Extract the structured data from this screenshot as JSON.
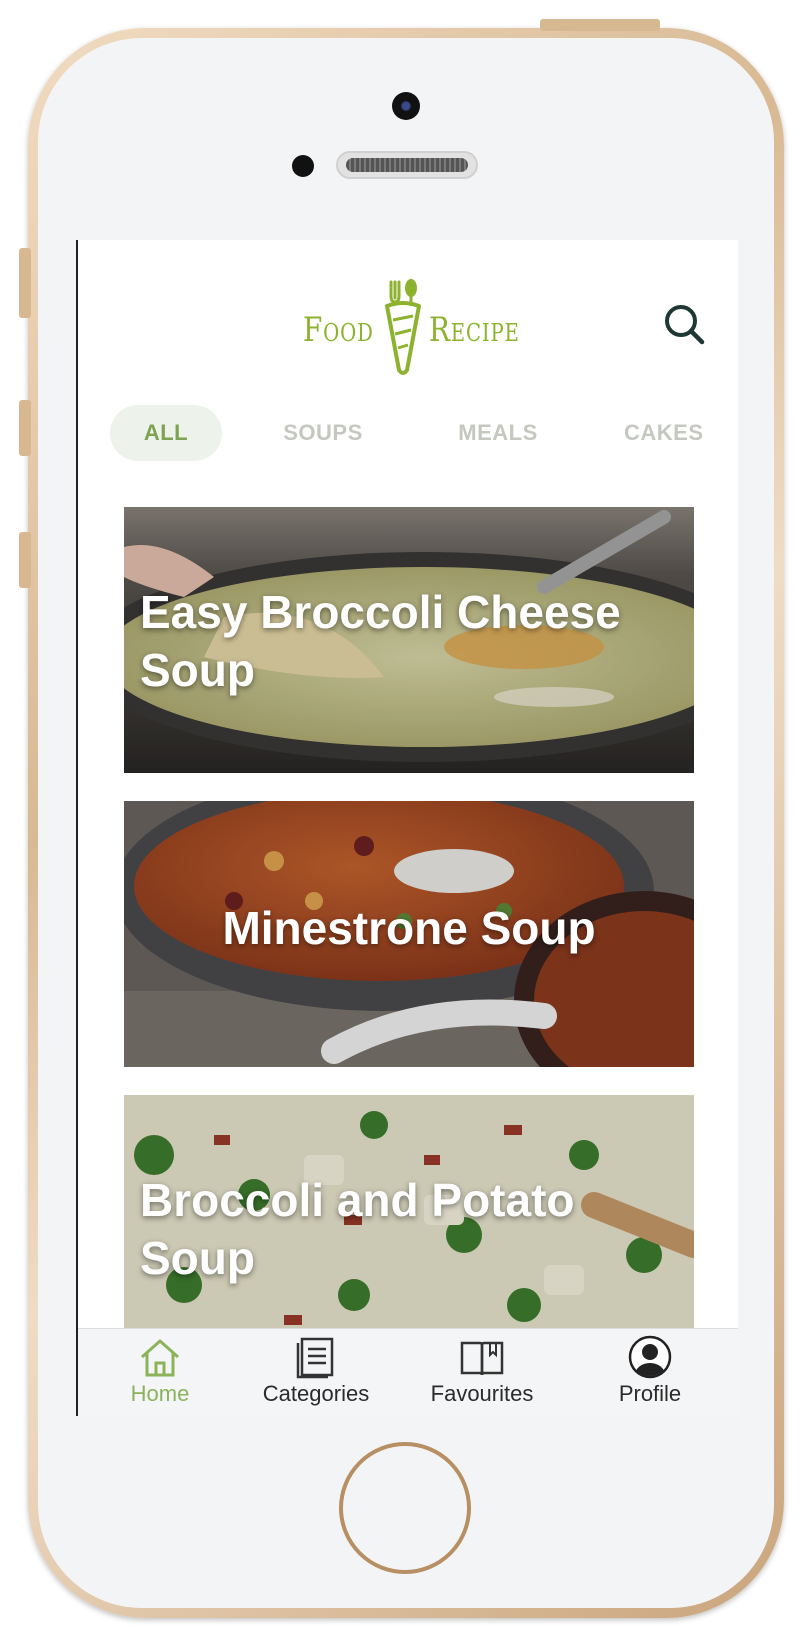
{
  "app": {
    "logo_left": "Food",
    "logo_right": "Recipe",
    "accent_color": "#8cb22e"
  },
  "header": {
    "search_icon": "search-icon"
  },
  "tabs": [
    {
      "label": "ALL",
      "active": true
    },
    {
      "label": "SOUPS",
      "active": false
    },
    {
      "label": "MEALS",
      "active": false
    },
    {
      "label": "CAKES",
      "active": false
    }
  ],
  "recipes": [
    {
      "title": "Easy Broccoli Cheese Soup"
    },
    {
      "title": "Minestrone Soup"
    },
    {
      "title": "Broccoli and Potato Soup"
    }
  ],
  "bottom_nav": [
    {
      "label": "Home",
      "icon": "home-icon",
      "active": true
    },
    {
      "label": "Categories",
      "icon": "list-icon",
      "active": false
    },
    {
      "label": "Favourites",
      "icon": "book-icon",
      "active": false
    },
    {
      "label": "Profile",
      "icon": "profile-icon",
      "active": false
    }
  ]
}
